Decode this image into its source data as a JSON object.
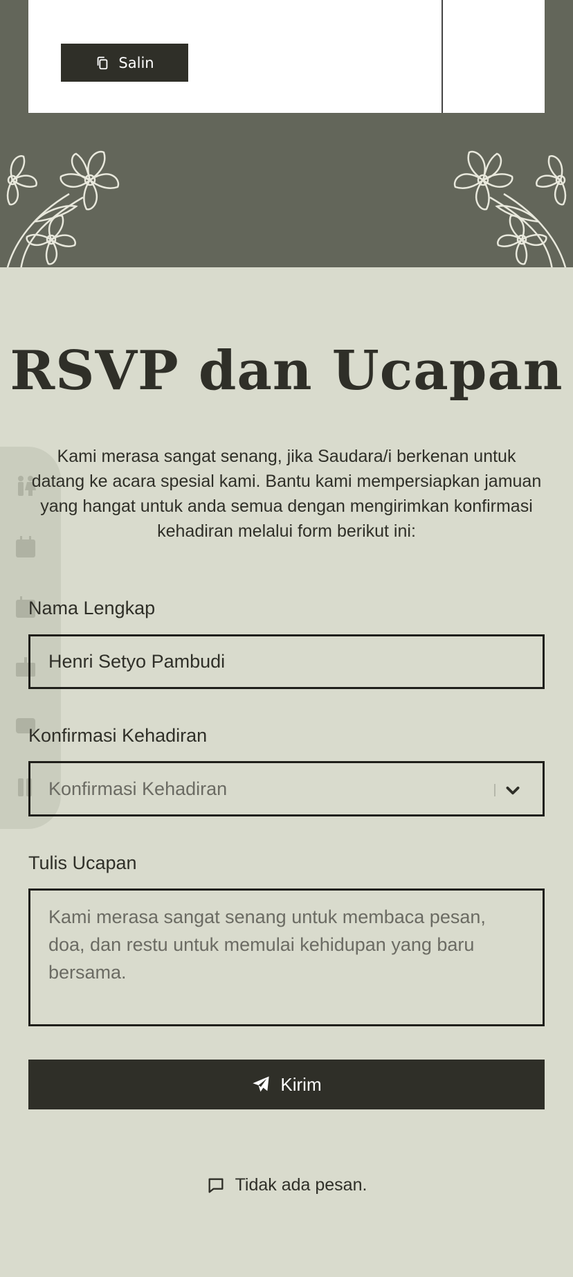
{
  "gift": {
    "copy_label": "Salin"
  },
  "rsvp": {
    "title": "RSVP dan Ucapan",
    "description": "Kami merasa sangat senang, jika Saudara/i berkenan untuk datang ke acara spesial kami. Bantu kami mempersiapkan jamuan yang hangat untuk anda semua dengan mengirimkan konfirmasi kehadiran melalui form berikut ini:"
  },
  "form": {
    "name_label": "Nama Lengkap",
    "name_value": "Henri Setyo Pambudi",
    "attendance_label": "Konfirmasi Kehadiran",
    "attendance_selected": "Konfirmasi Kehadiran",
    "message_label": "Tulis Ucapan",
    "message_placeholder": "Kami merasa sangat senang untuk membaca pesan, doa, dan restu untuk memulai kehidupan yang baru bersama.",
    "submit_label": "Kirim"
  },
  "messages": {
    "empty_text": "Tidak ada pesan."
  },
  "side_nav": [
    "couple-icon",
    "calendar-icon",
    "calendar-alt-icon",
    "gift-icon",
    "chat-icon",
    "book-icon"
  ],
  "colors": {
    "dark": "#2f2f28",
    "band": "#63665a",
    "background": "#d9dbcd",
    "flower": "#e8e8dc"
  }
}
